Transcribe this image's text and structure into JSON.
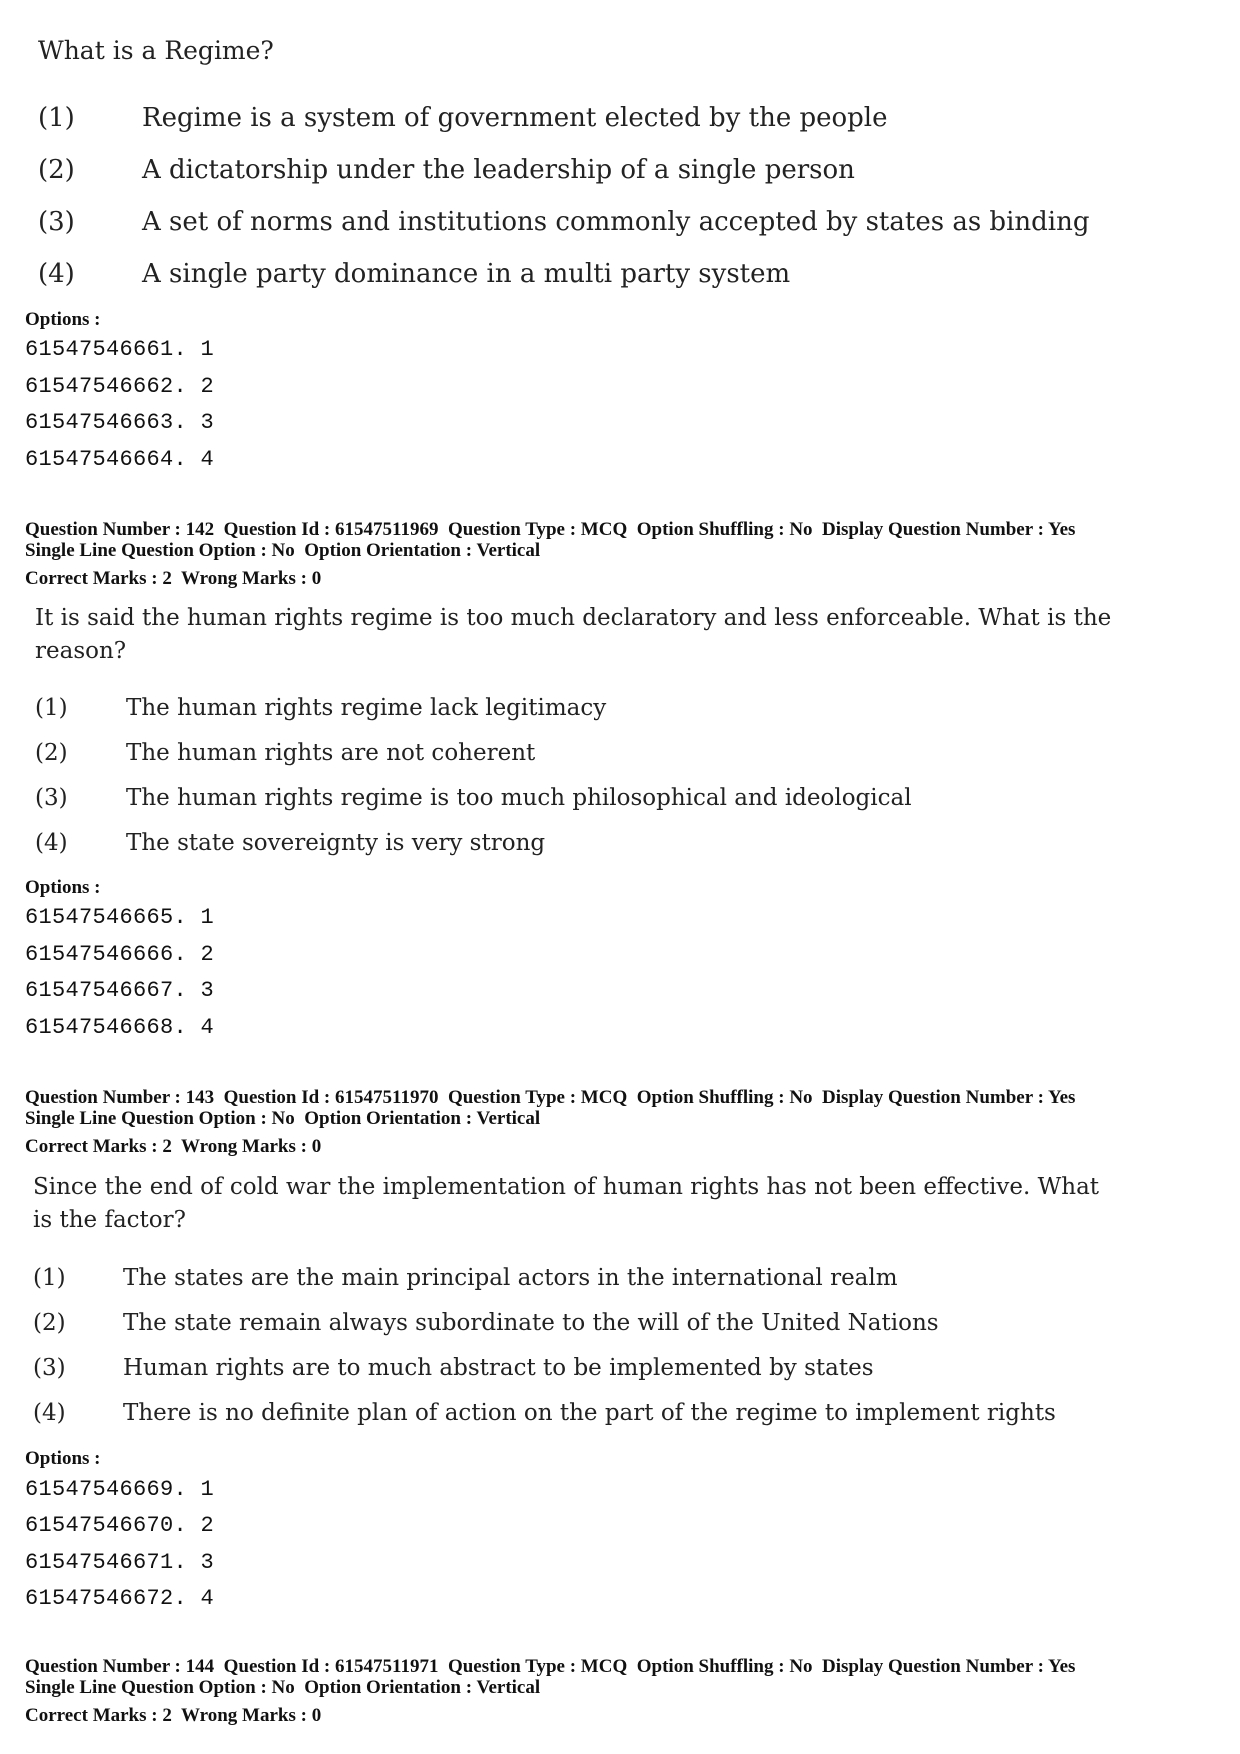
{
  "q141": {
    "question": "What is a Regime?",
    "choices": [
      {
        "num": "(1)",
        "text": "Regime is a system of government elected by the people"
      },
      {
        "num": "(2)",
        "text": "A dictatorship under the leadership of a single person"
      },
      {
        "num": "(3)",
        "text": "A set of norms and institutions commonly accepted by states as binding"
      },
      {
        "num": "(4)",
        "text": "A single party dominance in a multi party system"
      }
    ],
    "options_label": "Options :",
    "options": [
      "61547546661. 1",
      "61547546662. 2",
      "61547546663. 3",
      "61547546664. 4"
    ]
  },
  "q142": {
    "meta_line1": "Question Number : 142  Question Id : 61547511969  Question Type : MCQ  Option Shuffling : No  Display Question Number : Yes",
    "meta_line2": "Single Line Question Option : No  Option Orientation : Vertical",
    "marks": "Correct Marks : 2  Wrong Marks : 0",
    "question_line1": "It is said the human rights regime is too much declaratory  and less enforceable. What is the",
    "question_line2": "reason?",
    "choices": [
      {
        "num": "(1)",
        "text": "The human rights regime lack legitimacy"
      },
      {
        "num": "(2)",
        "text": "The human rights are not coherent"
      },
      {
        "num": "(3)",
        "text": "The human rights regime is too much philosophical and ideological"
      },
      {
        "num": "(4)",
        "text": "The state sovereignty is very strong"
      }
    ],
    "options_label": "Options :",
    "options": [
      "61547546665. 1",
      "61547546666. 2",
      "61547546667. 3",
      "61547546668. 4"
    ]
  },
  "q143": {
    "meta_line1": "Question Number : 143  Question Id : 61547511970  Question Type : MCQ  Option Shuffling : No  Display Question Number : Yes",
    "meta_line2": "Single Line Question Option : No  Option Orientation : Vertical",
    "marks": "Correct Marks : 2  Wrong Marks : 0",
    "question_line1": "Since  the end of cold war the implementation of human rights has not been effective. What",
    "question_line2": "is the factor?",
    "choices": [
      {
        "num": "(1)",
        "text": "The states are the main principal actors in the international realm"
      },
      {
        "num": "(2)",
        "text": "The state remain always subordinate to the will of the United Nations"
      },
      {
        "num": "(3)",
        "text": "Human rights are to much abstract to be implemented by states"
      },
      {
        "num": "(4)",
        "text": "There is no definite plan of action on the part of the regime to implement rights"
      }
    ],
    "options_label": "Options :",
    "options": [
      "61547546669. 1",
      "61547546670. 2",
      "61547546671. 3",
      "61547546672. 4"
    ]
  },
  "q144": {
    "meta_line1": "Question Number : 144  Question Id : 61547511971  Question Type : MCQ  Option Shuffling : No  Display Question Number : Yes",
    "meta_line2": "Single Line Question Option : No  Option Orientation : Vertical",
    "marks": "Correct Marks : 2  Wrong Marks : 0"
  }
}
